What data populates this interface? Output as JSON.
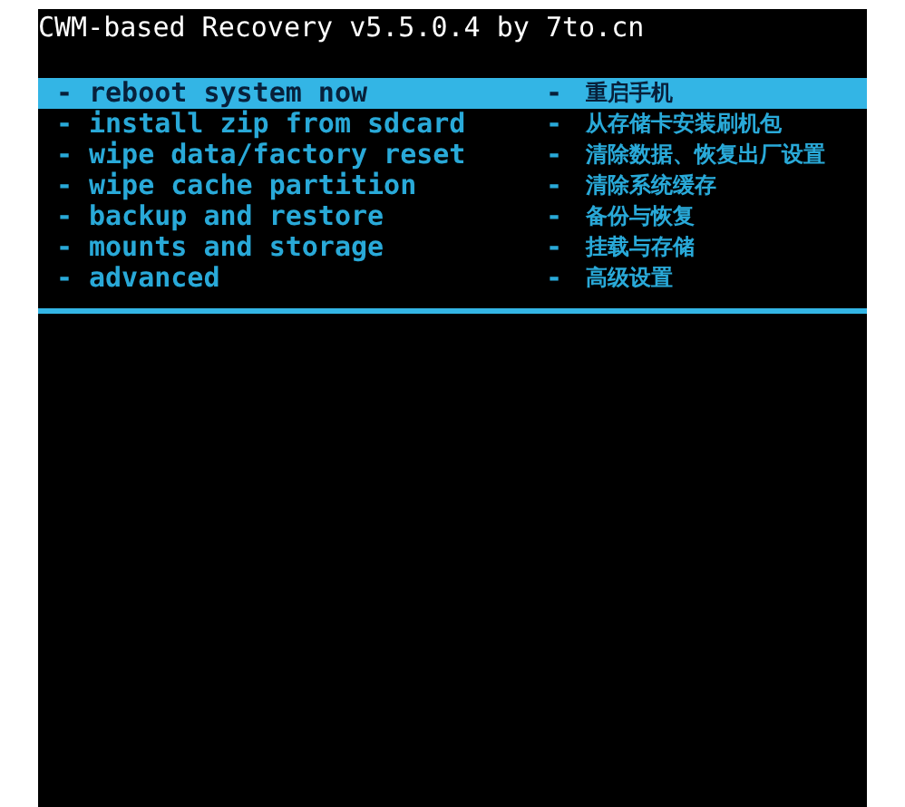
{
  "title": "CWM-based Recovery v5.5.0.4 by 7to.cn",
  "menu": [
    {
      "bullet": "-",
      "label": "reboot system now",
      "bullet_zh": "-",
      "label_zh": "重启手机",
      "selected": true
    },
    {
      "bullet": "-",
      "label": "install zip from sdcard",
      "bullet_zh": "-",
      "label_zh": "从存储卡安装刷机包",
      "selected": false
    },
    {
      "bullet": "-",
      "label": "wipe data/factory reset",
      "bullet_zh": "-",
      "label_zh": "清除数据、恢复出厂设置",
      "selected": false
    },
    {
      "bullet": "-",
      "label": "wipe cache partition",
      "bullet_zh": "-",
      "label_zh": "清除系统缓存",
      "selected": false
    },
    {
      "bullet": "-",
      "label": "backup and restore",
      "bullet_zh": "-",
      "label_zh": "备份与恢复",
      "selected": false
    },
    {
      "bullet": "-",
      "label": "mounts and storage",
      "bullet_zh": "-",
      "label_zh": "挂载与存储",
      "selected": false
    },
    {
      "bullet": "-",
      "label": "advanced",
      "bullet_zh": "-",
      "label_zh": "高级设置",
      "selected": false
    }
  ]
}
